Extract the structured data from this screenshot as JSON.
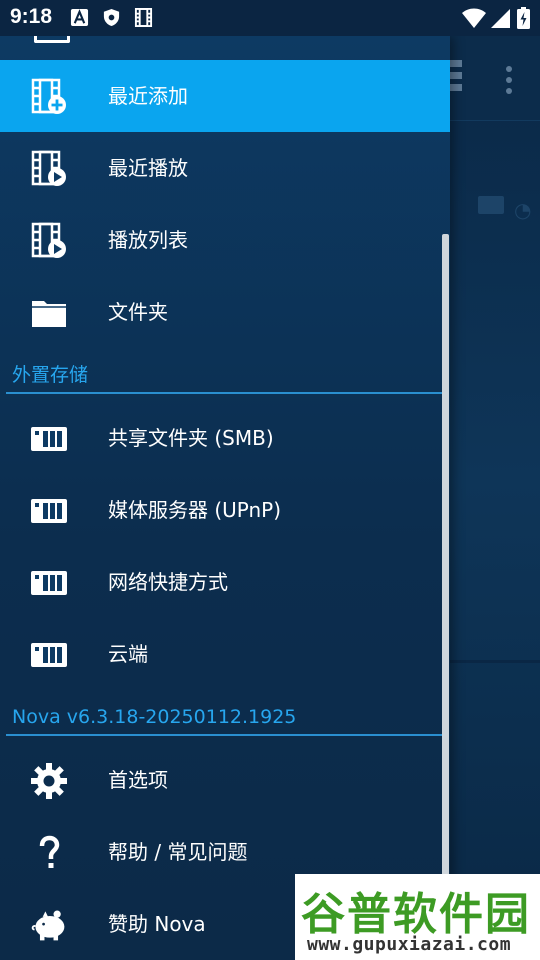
{
  "status_bar": {
    "time": "9:18",
    "left_icons": [
      "font-a-icon",
      "shield-icon",
      "film-icon"
    ],
    "right_icons": [
      "wifi-icon",
      "signal-icon",
      "battery-charging-icon"
    ]
  },
  "drawer": {
    "items": [
      {
        "id": "recent-added",
        "label": "最近添加",
        "icon": "film-plus-icon",
        "active": true
      },
      {
        "id": "recent-played",
        "label": "最近播放",
        "icon": "film-play-icon",
        "active": false
      },
      {
        "id": "playlist",
        "label": "播放列表",
        "icon": "film-play-icon",
        "active": false
      },
      {
        "id": "folder",
        "label": "文件夹",
        "icon": "folder-icon",
        "active": false
      }
    ],
    "external_section": "外置存储",
    "external_items": [
      {
        "id": "smb",
        "label": "共享文件夹 (SMB)",
        "icon": "nas-icon"
      },
      {
        "id": "upnp",
        "label": "媒体服务器 (UPnP)",
        "icon": "nas-icon"
      },
      {
        "id": "network-shortcuts",
        "label": "网络快捷方式",
        "icon": "nas-icon"
      },
      {
        "id": "cloud",
        "label": "云端",
        "icon": "nas-icon"
      }
    ],
    "version_section": "Nova v6.3.18-20250112.1925",
    "misc_items": [
      {
        "id": "preferences",
        "label": "首选项",
        "icon": "gear-icon"
      },
      {
        "id": "help",
        "label": "帮助 / 常见问题",
        "icon": "question-icon"
      },
      {
        "id": "donate",
        "label": "赞助 Nova",
        "icon": "piggy-bank-icon"
      }
    ]
  },
  "watermark": {
    "main": "谷普软件园",
    "sub": "www.gupuxiazai.com"
  },
  "colors": {
    "accent": "#0aa5ef",
    "section_text": "#27a6ee",
    "drawer_bg": "#0d3a63"
  }
}
